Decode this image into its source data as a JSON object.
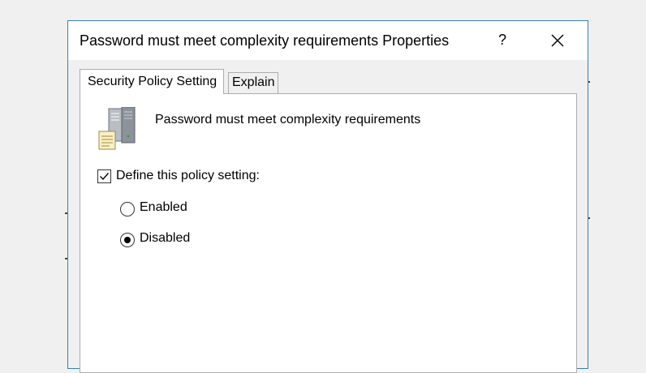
{
  "window": {
    "title": "Password must meet complexity requirements Properties",
    "help_label": "?"
  },
  "tabs": [
    {
      "label": "Security Policy Setting",
      "active": true
    },
    {
      "label": "Explain",
      "active": false
    }
  ],
  "policy": {
    "icon": "server-document-icon",
    "name": "Password must meet complexity requirements"
  },
  "define_setting": {
    "label": "Define this policy setting:",
    "checked": true
  },
  "options": [
    {
      "label": "Enabled",
      "selected": false
    },
    {
      "label": "Disabled",
      "selected": true
    }
  ],
  "colors": {
    "window_border": "#3c7fb1",
    "panel_bg": "#ffffff",
    "dialog_bg": "#f0f0f0"
  }
}
